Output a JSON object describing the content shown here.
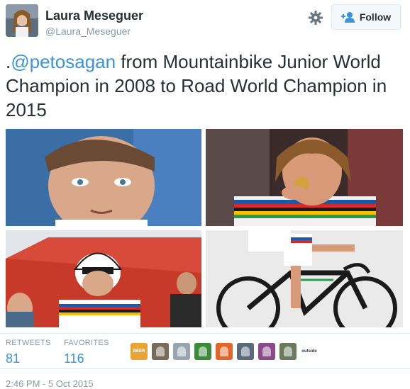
{
  "author": {
    "name": "Laura Meseguer",
    "handle": "@Laura_Meseguer"
  },
  "follow_button": {
    "label": "Follow",
    "icon": "add-user-icon"
  },
  "settings_icon": "gear-icon",
  "tweet": {
    "prefix": ".",
    "mention": "@petosagan",
    "text": " from Mountainbike Junior World Champion in 2008 to Road World Champion in 2015"
  },
  "photos": [
    {
      "description": "young-rider-closeup"
    },
    {
      "description": "rider-biting-medal"
    },
    {
      "description": "junior-rider-helmet"
    },
    {
      "description": "rider-on-road-bike"
    }
  ],
  "stats": {
    "retweets_label": "RETWEETS",
    "retweets_value": "81",
    "favorites_label": "FAVORITES",
    "favorites_value": "116"
  },
  "favoriter_avatars": [
    {
      "color": "#e8a534",
      "text": "BEER"
    },
    {
      "color": "#7a6a5a"
    },
    {
      "color": "#9aa4ae"
    },
    {
      "color": "#3a8a3a"
    },
    {
      "color": "#e0662a"
    },
    {
      "color": "#5a6a7a"
    },
    {
      "color": "#8a4a8a"
    },
    {
      "color": "#6a7a5a"
    },
    {
      "color": "#ffffff",
      "text": "outside"
    }
  ],
  "timestamp": "2:46 PM - 5 Oct 2015",
  "colors": {
    "link": "#3b94d9",
    "muted": "#8899a6",
    "text": "#292f33",
    "border": "#e1e8ed"
  }
}
